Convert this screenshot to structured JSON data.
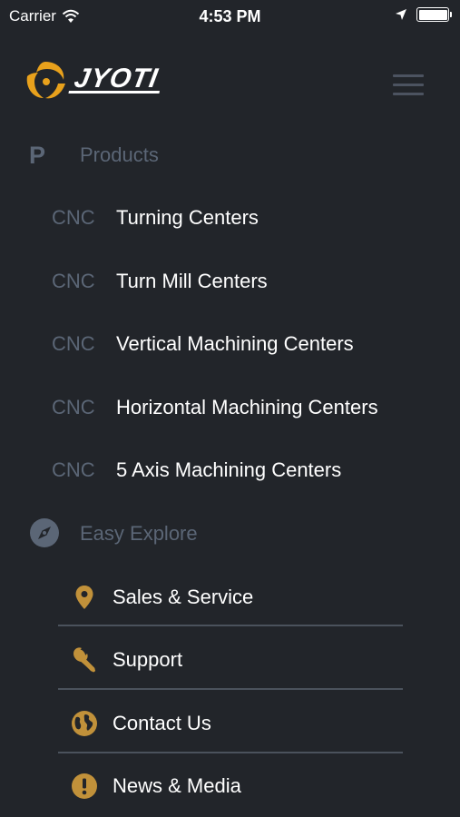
{
  "status_bar": {
    "carrier": "Carrier",
    "time": "4:53 PM"
  },
  "header": {
    "logo_text": "JYOTI"
  },
  "products": {
    "marker": "P",
    "title": "Products",
    "items": [
      {
        "tag": "CNC",
        "label": "Turning Centers"
      },
      {
        "tag": "CNC",
        "label": "Turn Mill Centers"
      },
      {
        "tag": "CNC",
        "label": "Vertical Machining Centers"
      },
      {
        "tag": "CNC",
        "label": "Horizontal Machining Centers"
      },
      {
        "tag": "CNC",
        "label": "5 Axis Machining Centers"
      }
    ]
  },
  "explore": {
    "title": "Easy Explore",
    "items": [
      {
        "icon": "map-pin-icon",
        "label": "Sales & Service"
      },
      {
        "icon": "wrench-icon",
        "label": "Support"
      },
      {
        "icon": "globe-icon",
        "label": "Contact Us"
      },
      {
        "icon": "exclamation-icon",
        "label": "News & Media"
      }
    ]
  },
  "colors": {
    "background": "#22252a",
    "accent": "#c1913a",
    "muted": "#5b6676",
    "divider": "#4b525c"
  }
}
